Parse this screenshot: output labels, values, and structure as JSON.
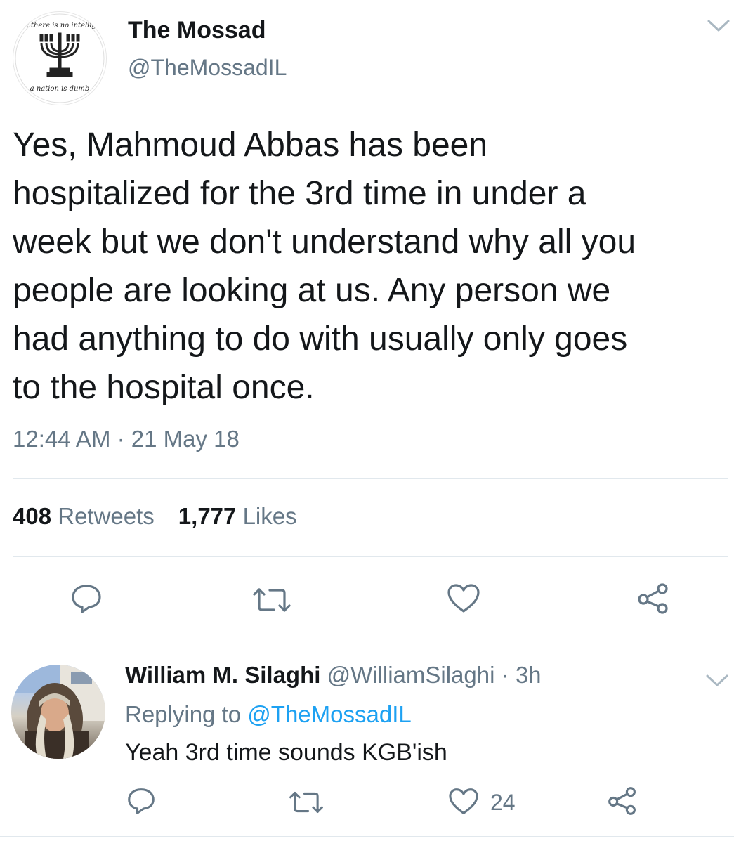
{
  "tweet": {
    "display_name": "The Mossad",
    "handle": "@TheMossadIL",
    "avatar_logo_text": "Where there is no intelligence a nation is dumb",
    "body_lines": [
      "Yes, Mahmoud Abbas has been",
      "hospitalized for the 3rd time in under a",
      "week but we don't understand why all you",
      "people are looking at us. Any person we",
      "had anything to do with usually only goes",
      "to the hospital once."
    ],
    "timestamp": "12:44 AM · 21 May 18",
    "retweets_count": "408",
    "retweets_label": "Retweets",
    "likes_count": "1,777",
    "likes_label": "Likes",
    "actions": [
      "reply-icon",
      "retweet-icon",
      "like-icon",
      "share-icon"
    ]
  },
  "reply": {
    "display_name": "William M. Silaghi",
    "handle": "@WilliamSilaghi",
    "time": "3h",
    "separator": "·",
    "replying_label": "Replying to",
    "replying_mention": "@TheMossadIL",
    "text": "Yeah 3rd time sounds KGB'ish",
    "likes_count": "24"
  },
  "colors": {
    "text": "#14171a",
    "secondary": "#657786",
    "link": "#1da1f2",
    "divider": "#e1e8ed",
    "icon": "#657786"
  }
}
